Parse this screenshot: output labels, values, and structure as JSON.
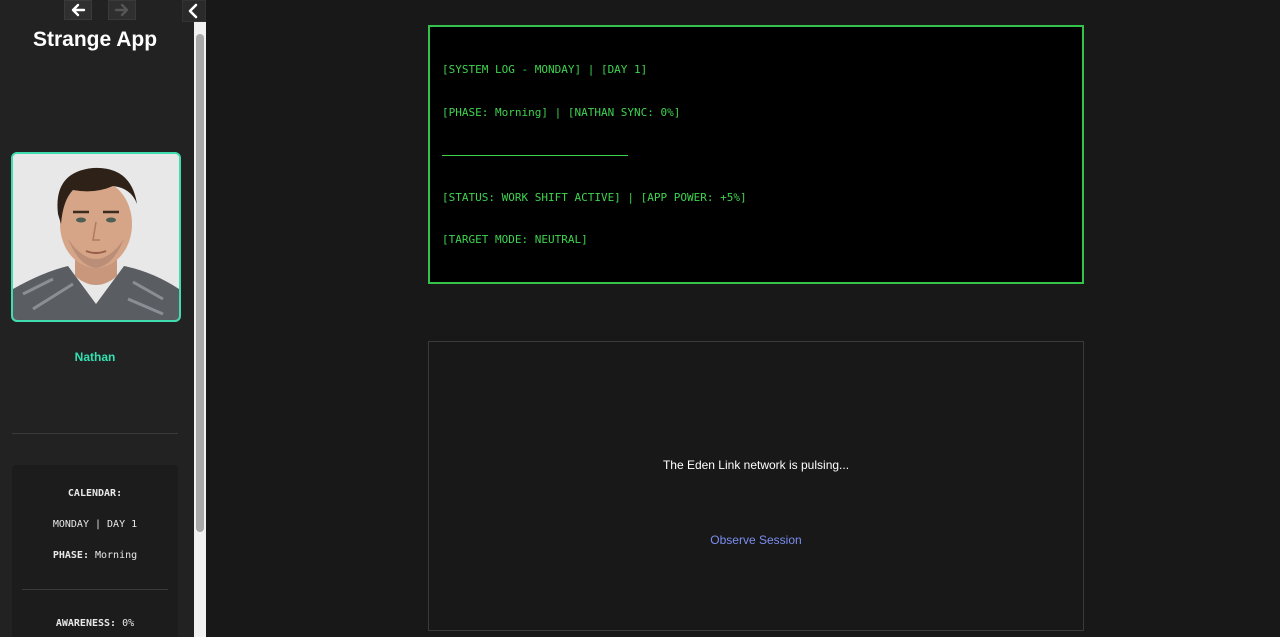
{
  "sidebar": {
    "app_title": "Strange App",
    "character_name": "Nathan",
    "calendar_label": "CALENDAR:",
    "calendar_value": "MONDAY | DAY 1",
    "phase_label": "PHASE:",
    "phase_value": "Morning",
    "awareness_label": "AWARENESS:",
    "awareness_value": "0%"
  },
  "terminal": {
    "lines": [
      "[SYSTEM LOG - MONDAY] | [DAY 1]",
      "[PHASE: Morning] | [NATHAN SYNC: 0%]",
      "[STATUS: WORK SHIFT ACTIVE] | [APP POWER: +5%]",
      "[TARGET MODE: NEUTRAL]"
    ]
  },
  "event": {
    "text": "The Eden Link network is pulsing...",
    "link_label": "Observe Session"
  },
  "colors": {
    "accent": "#33e0b0",
    "terminal_green": "#3ed34f",
    "link": "#7b8ef0"
  },
  "icons": {
    "back": "arrow-left-icon",
    "forward": "arrow-right-icon",
    "collapse": "chevron-left-icon"
  }
}
